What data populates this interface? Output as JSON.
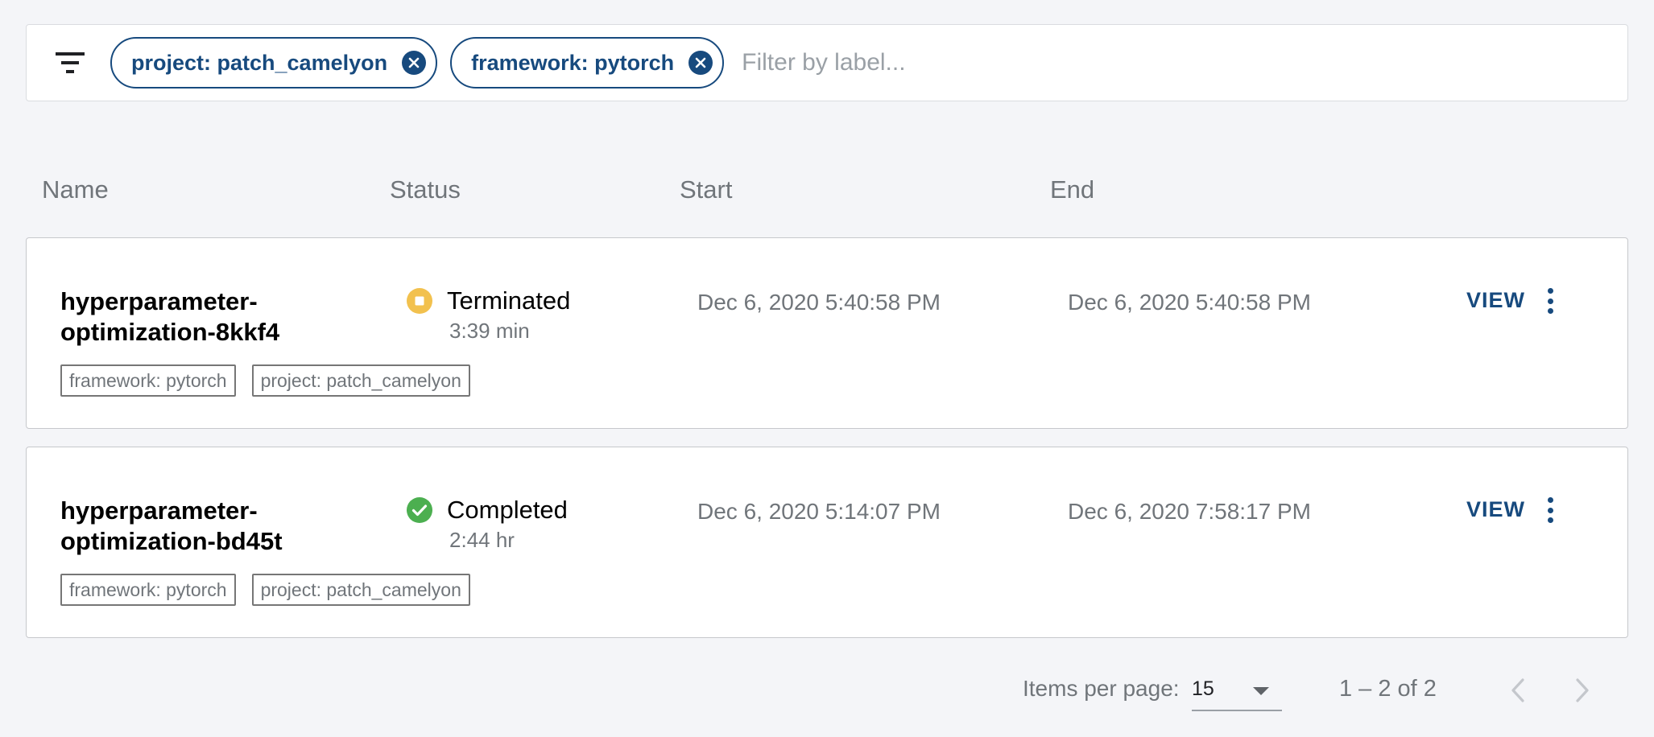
{
  "filter": {
    "chips": [
      {
        "label": "project: patch_camelyon"
      },
      {
        "label": "framework: pytorch"
      }
    ],
    "placeholder": "Filter by label..."
  },
  "columns": {
    "name": "Name",
    "status": "Status",
    "start": "Start",
    "end": "End"
  },
  "runs": [
    {
      "name_line1": "hyperparameter-",
      "name_line2": "optimization-8kkf4",
      "status": "Terminated",
      "status_icon": "stop-circle-icon",
      "status_color": "#f2c14e",
      "duration": "3:39 min",
      "start": "Dec 6, 2020 5:40:58 PM",
      "end": "Dec 6, 2020 5:40:58 PM",
      "tags": [
        "framework: pytorch",
        "project: patch_camelyon"
      ],
      "view_label": "VIEW"
    },
    {
      "name_line1": "hyperparameter-",
      "name_line2": "optimization-bd45t",
      "status": "Completed",
      "status_icon": "check-circle-icon",
      "status_color": "#4caf50",
      "duration": "2:44 hr",
      "start": "Dec 6, 2020 5:14:07 PM",
      "end": "Dec 6, 2020 7:58:17 PM",
      "tags": [
        "framework: pytorch",
        "project: patch_camelyon"
      ],
      "view_label": "VIEW"
    }
  ],
  "paginator": {
    "items_per_page_label": "Items per page:",
    "page_size": "15",
    "range": "1 – 2 of 2"
  },
  "colors": {
    "accent": "#174a7e",
    "background": "#f4f5f8"
  }
}
